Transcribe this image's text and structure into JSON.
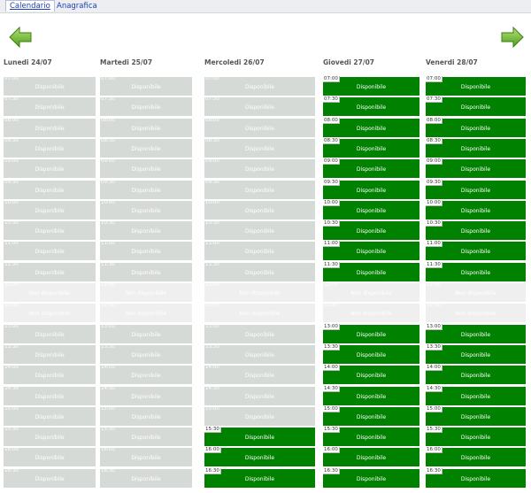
{
  "tabs": [
    {
      "label": "Calendario",
      "active": true
    },
    {
      "label": "Anagrafica",
      "active": false
    }
  ],
  "nav": {
    "prev_icon": "arrow-left-icon",
    "next_icon": "arrow-right-icon",
    "arrow_color": "#7ac143"
  },
  "slot_labels": {
    "available": "Disponibile",
    "unavailable": "Non disponibile"
  },
  "colors": {
    "green": "#018100",
    "grey": "#d6dad6",
    "none": "#efefef"
  },
  "times": [
    "07:00",
    "07:30",
    "08:00",
    "08:30",
    "09:00",
    "09:30",
    "10:00",
    "10:30",
    "11:00",
    "11:30",
    "12:00",
    "12:30",
    "13:00",
    "13:30",
    "14:00",
    "14:30",
    "15:00",
    "15:30",
    "16:00",
    "16:30"
  ],
  "days": [
    {
      "name": "Lunedi 24/07",
      "states": [
        "grey",
        "grey",
        "grey",
        "grey",
        "grey",
        "grey",
        "grey",
        "grey",
        "grey",
        "grey",
        "none",
        "none",
        "grey",
        "grey",
        "grey",
        "grey",
        "grey",
        "grey",
        "grey",
        "grey"
      ]
    },
    {
      "name": "Martedi 25/07",
      "states": [
        "grey",
        "grey",
        "grey",
        "grey",
        "grey",
        "grey",
        "grey",
        "grey",
        "grey",
        "grey",
        "none",
        "none",
        "grey",
        "grey",
        "grey",
        "grey",
        "grey",
        "grey",
        "grey",
        "grey"
      ]
    },
    {
      "name": "Mercoledi 26/07",
      "states": [
        "grey",
        "grey",
        "grey",
        "grey",
        "grey",
        "grey",
        "grey",
        "grey",
        "grey",
        "grey",
        "none",
        "none",
        "grey",
        "grey",
        "grey",
        "grey",
        "grey",
        "green",
        "green",
        "green"
      ]
    },
    {
      "name": "Giovedi 27/07",
      "states": [
        "green",
        "green",
        "green",
        "green",
        "green",
        "green",
        "green",
        "green",
        "green",
        "green",
        "none",
        "none",
        "green",
        "green",
        "green",
        "green",
        "green",
        "green",
        "green",
        "green"
      ]
    },
    {
      "name": "Venerdi 28/07",
      "states": [
        "green",
        "green",
        "green",
        "green",
        "green",
        "green",
        "green",
        "green",
        "green",
        "green",
        "none",
        "none",
        "green",
        "green",
        "green",
        "green",
        "green",
        "green",
        "green",
        "green"
      ]
    }
  ]
}
